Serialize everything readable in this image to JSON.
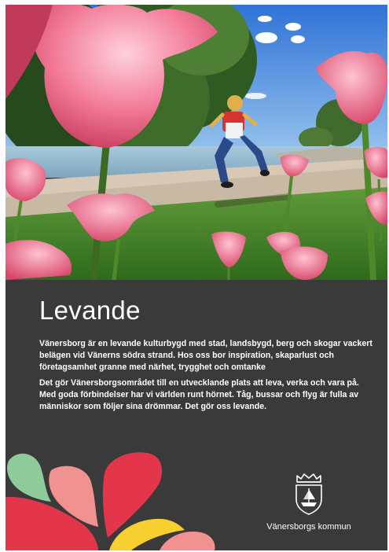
{
  "poster": {
    "headline": "Levande",
    "paragraph_1": "Vänersborg är en levande kulturbygd med stad, landsbygd, berg och skogar vackert belägen vid Vänerns södra strand. Hos oss bor inspiration, skaparlust och företagsamhet granne med närhet, trygghet och omtanke",
    "paragraph_2": "Det gör Vänersborgsområdet till en utvecklande plats att leva, verka och vara på. Med goda förbindelser har vi världen runt hörnet. Tåg, bussar och flyg är fulla av människor som följer sina drömmar. Det gör oss levande."
  },
  "logo": {
    "name": "Vänersborgs kommun",
    "icon": "coat-of-arms-icon"
  },
  "colors": {
    "panel_background": "#3a3a3a",
    "text": "#ffffff",
    "petal_green": "#8fca9a",
    "petal_pink": "#f19190",
    "petal_red": "#e4364b",
    "petal_yellow": "#f7cf2e"
  }
}
